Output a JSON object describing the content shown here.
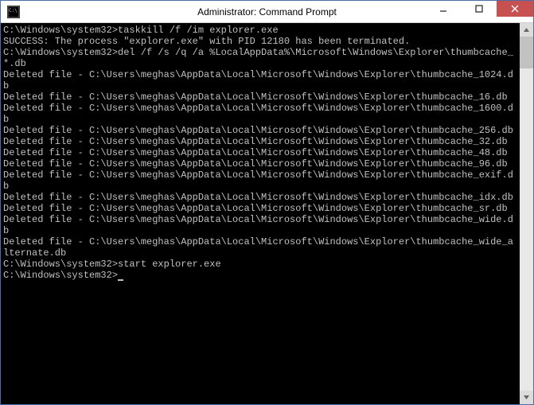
{
  "window": {
    "title": "Administrator: Command Prompt"
  },
  "controls": {
    "min": "minimize",
    "max": "maximize",
    "close": "close"
  },
  "terminal": {
    "lines": [
      "C:\\Windows\\system32>taskkill /f /im explorer.exe",
      "SUCCESS: The process \"explorer.exe\" with PID 12180 has been terminated.",
      "",
      "C:\\Windows\\system32>del /f /s /q /a %LocalAppData%\\Microsoft\\Windows\\Explorer\\thumbcache_*.db",
      "Deleted file - C:\\Users\\meghas\\AppData\\Local\\Microsoft\\Windows\\Explorer\\thumbcache_1024.db",
      "Deleted file - C:\\Users\\meghas\\AppData\\Local\\Microsoft\\Windows\\Explorer\\thumbcache_16.db",
      "Deleted file - C:\\Users\\meghas\\AppData\\Local\\Microsoft\\Windows\\Explorer\\thumbcache_1600.db",
      "Deleted file - C:\\Users\\meghas\\AppData\\Local\\Microsoft\\Windows\\Explorer\\thumbcache_256.db",
      "Deleted file - C:\\Users\\meghas\\AppData\\Local\\Microsoft\\Windows\\Explorer\\thumbcache_32.db",
      "Deleted file - C:\\Users\\meghas\\AppData\\Local\\Microsoft\\Windows\\Explorer\\thumbcache_48.db",
      "Deleted file - C:\\Users\\meghas\\AppData\\Local\\Microsoft\\Windows\\Explorer\\thumbcache_96.db",
      "Deleted file - C:\\Users\\meghas\\AppData\\Local\\Microsoft\\Windows\\Explorer\\thumbcache_exif.db",
      "Deleted file - C:\\Users\\meghas\\AppData\\Local\\Microsoft\\Windows\\Explorer\\thumbcache_idx.db",
      "Deleted file - C:\\Users\\meghas\\AppData\\Local\\Microsoft\\Windows\\Explorer\\thumbcache_sr.db",
      "Deleted file - C:\\Users\\meghas\\AppData\\Local\\Microsoft\\Windows\\Explorer\\thumbcache_wide.db",
      "Deleted file - C:\\Users\\meghas\\AppData\\Local\\Microsoft\\Windows\\Explorer\\thumbcache_wide_alternate.db",
      "",
      "C:\\Windows\\system32>start explorer.exe",
      "",
      "C:\\Windows\\system32>"
    ],
    "cursor_line_index": 19
  }
}
